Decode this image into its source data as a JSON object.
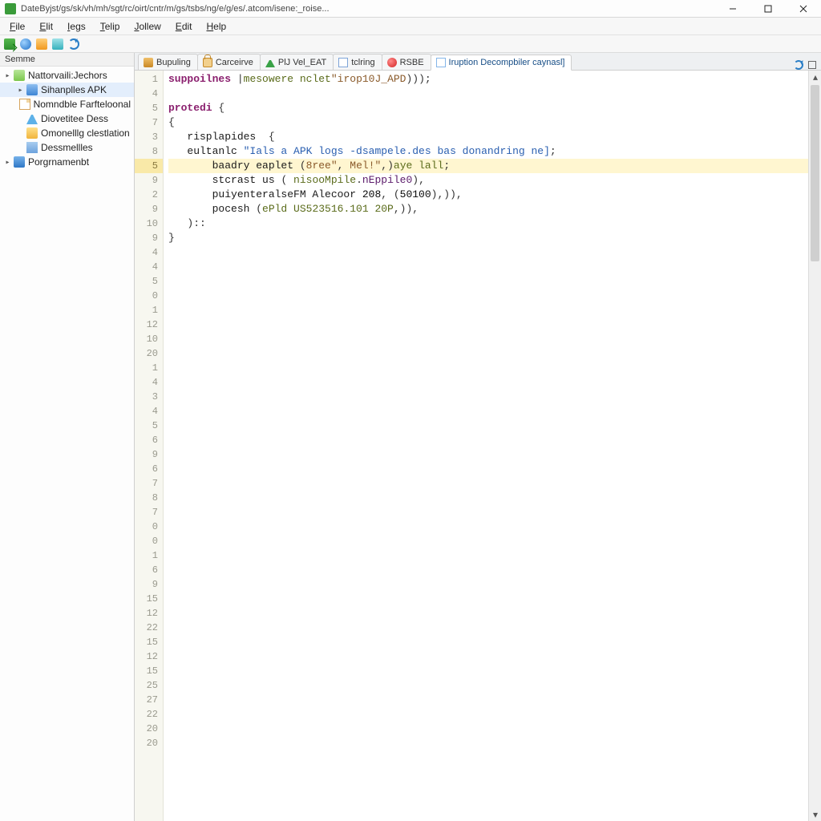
{
  "window": {
    "title": "DateByjst/gs/sk/vh/mh/sgt/rc/oirt/cntr/m/gs/tsbs/ng/e/g/es/.atcom/isene:_roise..."
  },
  "menu": {
    "items": [
      {
        "label": "File",
        "underline": 0
      },
      {
        "label": "Elit",
        "underline": 0
      },
      {
        "label": "Iegs",
        "underline": 0
      },
      {
        "label": "Telip",
        "underline": 0
      },
      {
        "label": "Jollew",
        "underline": 0
      },
      {
        "label": "Edit",
        "underline": 0
      },
      {
        "label": "Help",
        "underline": 0
      }
    ]
  },
  "toolbar": {
    "buttons": [
      {
        "name": "import-button",
        "icon": "green-import"
      },
      {
        "name": "globe-button",
        "icon": "blue-globe"
      },
      {
        "name": "newdoc-button",
        "icon": "orange-doc"
      },
      {
        "name": "open-button",
        "icon": "cyan-open"
      },
      {
        "name": "refresh-button",
        "icon": "refresh"
      }
    ]
  },
  "sidebar": {
    "header": "Semme",
    "tree": [
      {
        "depth": 0,
        "expander": "▸",
        "icon": "package",
        "label": "Nattorvaili:Jechors",
        "selected": false
      },
      {
        "depth": 1,
        "expander": "▸",
        "icon": "cube",
        "label": "Sihanplles APK",
        "selected": true
      },
      {
        "depth": 1,
        "expander": "",
        "icon": "page",
        "label": "Nomndble Farfteloonal",
        "selected": false
      },
      {
        "depth": 1,
        "expander": "",
        "icon": "flask",
        "label": "Diovetitee Dess",
        "selected": false
      },
      {
        "depth": 1,
        "expander": "",
        "icon": "amber",
        "label": "Omonelllg clestlation",
        "selected": false
      },
      {
        "depth": 1,
        "expander": "",
        "icon": "grid",
        "label": "Dessmellles",
        "selected": false
      },
      {
        "depth": 0,
        "expander": "▸",
        "icon": "blue",
        "label": "Porgrnamenbt",
        "selected": false
      }
    ]
  },
  "tabs": {
    "items": [
      {
        "icon": "box",
        "label": "Bupuling",
        "active": false
      },
      {
        "icon": "lock",
        "label": "Carceirve",
        "active": false
      },
      {
        "icon": "uparr",
        "label": "PlJ Vel_EAT",
        "active": false
      },
      {
        "icon": "doc",
        "label": "tclring",
        "active": false
      },
      {
        "icon": "red",
        "label": "RSBE",
        "active": false
      },
      {
        "icon": "class",
        "label": "Iruption Decompbiler caynasl]",
        "active": true
      }
    ]
  },
  "editor": {
    "gutter": [
      "1",
      "4",
      "5",
      "7",
      "3",
      "8",
      "5",
      "9",
      "2",
      "9",
      "10",
      "9",
      "4",
      "4",
      "5",
      "0",
      "1",
      "12",
      "10",
      "20",
      "1",
      "4",
      "3",
      "4",
      "5",
      "6",
      "9",
      "6",
      "7",
      "8",
      "7",
      "0",
      "0",
      "1",
      "6",
      "9",
      "15",
      "12",
      "22",
      "15",
      "12",
      "15",
      "25",
      "27",
      "22",
      "20",
      "20"
    ],
    "highlight_index": 6,
    "lines": [
      {
        "tokens": [
          {
            "t": "suppoilnes ",
            "c": "kw"
          },
          {
            "t": "|",
            "c": "pn"
          },
          {
            "t": "mesowere nclet",
            "c": "type"
          },
          {
            "t": "\"irop10J_APD",
            "c": "brown"
          },
          {
            "t": ")));",
            "c": "pn"
          }
        ]
      },
      {
        "tokens": []
      },
      {
        "tokens": [
          {
            "t": "protedi ",
            "c": "kw"
          },
          {
            "t": "{",
            "c": "pn"
          }
        ]
      },
      {
        "tokens": [
          {
            "t": "{",
            "c": "pn"
          }
        ]
      },
      {
        "tokens": [
          {
            "t": "   risplapides  ",
            "c": "id"
          },
          {
            "t": "{",
            "c": "pn"
          }
        ]
      },
      {
        "tokens": [
          {
            "t": "   eultanlc ",
            "c": "id"
          },
          {
            "t": "\"Ials a APK logs -dsampele.des bas donandring ne]",
            "c": "str"
          },
          {
            "t": ";",
            "c": "pn"
          }
        ]
      },
      {
        "tokens": [
          {
            "t": "       baadry eaplet ",
            "c": "id"
          },
          {
            "t": "(",
            "c": "pn"
          },
          {
            "t": "8ree\"",
            "c": "brown"
          },
          {
            "t": ", ",
            "c": "pn"
          },
          {
            "t": "Mel!\"",
            "c": "brown"
          },
          {
            "t": ",)",
            "c": "pn"
          },
          {
            "t": "aye lall",
            "c": "type"
          },
          {
            "t": ";",
            "c": "pn"
          }
        ],
        "hl": true
      },
      {
        "tokens": [
          {
            "t": "       stcrast us ",
            "c": "id"
          },
          {
            "t": "( ",
            "c": "pn"
          },
          {
            "t": "nisooMpile",
            "c": "type"
          },
          {
            "t": ".",
            "c": "pn"
          },
          {
            "t": "nEppile0",
            "c": "call"
          },
          {
            "t": "),",
            "c": "pn"
          }
        ]
      },
      {
        "tokens": [
          {
            "t": "       puiyenteralseFM Alecoor ",
            "c": "id"
          },
          {
            "t": "208",
            "c": "num"
          },
          {
            "t": ", (",
            "c": "pn"
          },
          {
            "t": "50100",
            "c": "num"
          },
          {
            "t": "),)),",
            "c": "pn"
          }
        ]
      },
      {
        "tokens": [
          {
            "t": "       pocesh ",
            "c": "id"
          },
          {
            "t": "(",
            "c": "pn"
          },
          {
            "t": "ePld US523516.101 20P",
            "c": "type"
          },
          {
            "t": ",)),",
            "c": "pn"
          }
        ]
      },
      {
        "tokens": [
          {
            "t": "   )::",
            "c": "pn"
          }
        ]
      },
      {
        "tokens": [
          {
            "t": "}",
            "c": "pn"
          }
        ]
      }
    ]
  }
}
